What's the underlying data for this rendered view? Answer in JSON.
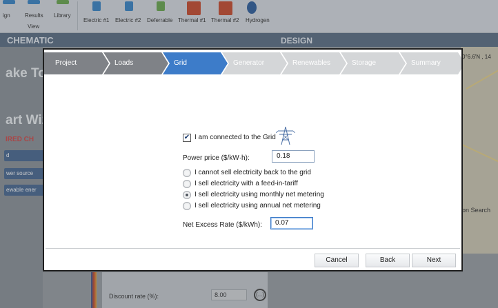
{
  "ribbon": {
    "design_label": "ign",
    "results_label": "Results",
    "library_label": "Library",
    "view_label": "View",
    "components": [
      "Electric #1",
      "Electric #2",
      "Deferrable",
      "Thermal #1",
      "Thermal #2",
      "Hydrogen"
    ]
  },
  "header": {
    "schematic_title": "CHEMATIC",
    "design_title": "DESIGN"
  },
  "left_panel": {
    "take_tour": "ake To",
    "start_wizard": "art Wiz",
    "required_changes": "IRED CH",
    "items": [
      "d",
      "wer source",
      "ewable ener"
    ]
  },
  "map": {
    "coordinates": "0°6.6'N , 14",
    "search": "ion Search"
  },
  "bottom_form": {
    "discount_label": "Discount rate (%):",
    "discount_value": "8.00",
    "help_glyph": "(...)"
  },
  "wizard": {
    "steps": [
      {
        "label": "Project",
        "state": "done"
      },
      {
        "label": "Loads",
        "state": "done"
      },
      {
        "label": "Grid",
        "state": "active"
      },
      {
        "label": "Generator",
        "state": "pending"
      },
      {
        "label": "Renewables",
        "state": "pending"
      },
      {
        "label": "Storage",
        "state": "pending"
      },
      {
        "label": "Summary",
        "state": "pending"
      }
    ],
    "grid_checkbox_label": "I am connected to the Grid",
    "grid_checked": true,
    "power_price_label": "Power price ($/kW·h):",
    "power_price_value": "0.18",
    "options": [
      {
        "label": "I cannot sell electricity back to the grid",
        "selected": false
      },
      {
        "label": "I sell electricity with a feed-in-tariff",
        "selected": false
      },
      {
        "label": "I sell electricity using monthly net metering",
        "selected": true
      },
      {
        "label": "I sell electricity using annual net metering",
        "selected": false
      }
    ],
    "net_excess_label": "Net Excess Rate ($/kWh):",
    "net_excess_value": "0.07",
    "buttons": {
      "cancel": "Cancel",
      "back": "Back",
      "next": "Next"
    }
  },
  "colors": {
    "active_step": "#3d7cc9",
    "done_step": "#7f8287",
    "pending_step": "#d4d6d8",
    "header_bar": "#5c6f86"
  }
}
